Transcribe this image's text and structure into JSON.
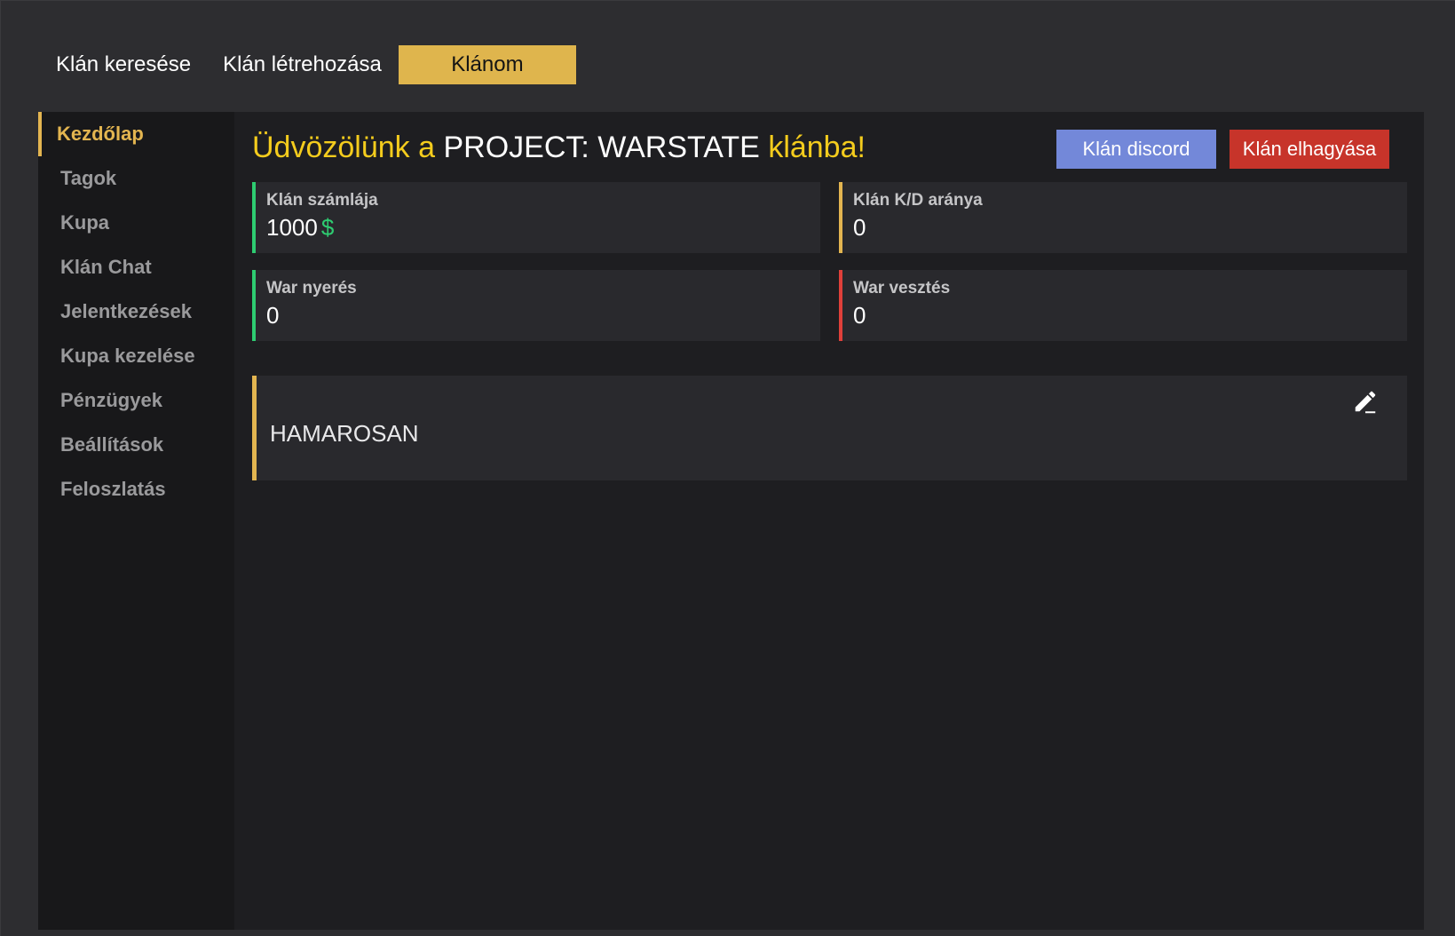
{
  "topnav": {
    "items": [
      {
        "label": "Klán keresése",
        "active": false
      },
      {
        "label": "Klán létrehozása",
        "active": false
      },
      {
        "label": "Klánom",
        "active": true
      }
    ]
  },
  "sidebar": {
    "items": [
      {
        "label": "Kezdőlap",
        "active": true
      },
      {
        "label": "Tagok"
      },
      {
        "label": "Kupa"
      },
      {
        "label": "Klán Chat"
      },
      {
        "label": "Jelentkezések"
      },
      {
        "label": "Kupa kezelése"
      },
      {
        "label": "Pénzügyek"
      },
      {
        "label": "Beállítások"
      },
      {
        "label": "Feloszlatás"
      }
    ]
  },
  "header": {
    "welcome_prefix": "Üdvözölünk a",
    "clan_name": "PROJECT: WARSTATE",
    "welcome_suffix": "klánba!"
  },
  "actions": {
    "discord_label": "Klán discord",
    "leave_label": "Klán elhagyása"
  },
  "stats": {
    "balance": {
      "label": "Klán számlája",
      "value": "1000",
      "currency": "$"
    },
    "kd": {
      "label": "Klán K/D aránya",
      "value": "0"
    },
    "war_wins": {
      "label": "War nyerés",
      "value": "0"
    },
    "war_losses": {
      "label": "War vesztés",
      "value": "0"
    }
  },
  "notice": {
    "text": "HAMAROSAN",
    "edit_icon": "pencil-icon"
  },
  "colors": {
    "accent": "#e3b550",
    "title_highlight": "#f4cc1d",
    "discord": "#7388d9",
    "danger": "#c7342a",
    "success": "#2ecc71",
    "loss": "#e0403a"
  }
}
